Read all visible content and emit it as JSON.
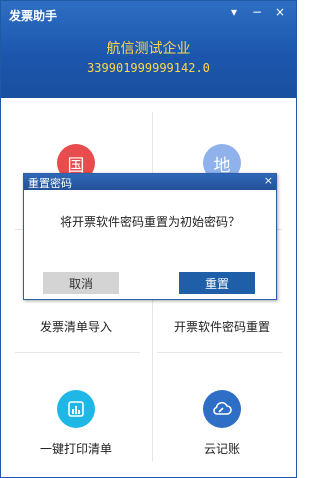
{
  "window": {
    "title": "发票助手",
    "controls": {
      "menu": "▾",
      "minimize": "−",
      "close": "×"
    }
  },
  "header": {
    "company": "航信测试企业",
    "tax_id": "339901999999142.0"
  },
  "tiles": [
    {
      "icon": "国",
      "icon_color": "#e84c4c",
      "label": ""
    },
    {
      "icon": "地",
      "icon_color": "#8fb2ec",
      "label": ""
    },
    {
      "label": "发票清单导入"
    },
    {
      "label": "开票软件密码重置"
    },
    {
      "icon": "printer",
      "icon_color": "#1fb8e6",
      "label": "一键打印清单"
    },
    {
      "icon": "cloud",
      "icon_color": "#2e6ec6",
      "label": "云记账"
    }
  ],
  "dialog": {
    "title": "重置密码",
    "close": "×",
    "message": "将开票软件密码重置为初始密码？",
    "cancel_label": "取消",
    "confirm_label": "重置"
  },
  "colors": {
    "titlebar": "#1c57ad",
    "accent_text": "#ffd84a",
    "primary_button": "#1f5ea8"
  }
}
